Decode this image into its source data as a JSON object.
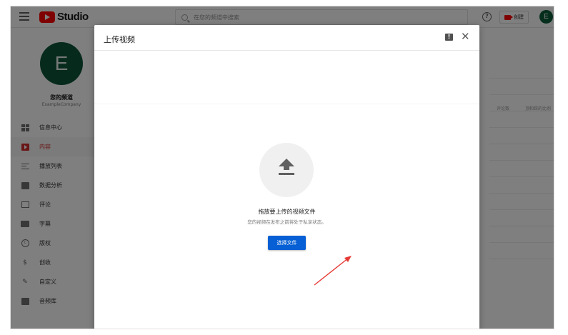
{
  "topbar": {
    "logo_text": "Studio",
    "search_placeholder": "在您的频道中搜索",
    "help_symbol": "?",
    "create_label": "创建",
    "avatar_letter": "E"
  },
  "sidebar": {
    "avatar_letter": "E",
    "channel_name": "您的频道",
    "channel_sub": "ExampleCompany",
    "items": [
      {
        "label": "信息中心",
        "icon": "dashboard-icon"
      },
      {
        "label": "内容",
        "icon": "content-icon",
        "active": true
      },
      {
        "label": "播放列表",
        "icon": "playlist-icon"
      },
      {
        "label": "数据分析",
        "icon": "analytics-icon"
      },
      {
        "label": "评论",
        "icon": "comments-icon"
      },
      {
        "label": "字幕",
        "icon": "subtitles-icon"
      },
      {
        "label": "版权",
        "icon": "copyright-icon"
      },
      {
        "label": "创收",
        "icon": "monetization-icon"
      },
      {
        "label": "自定义",
        "icon": "customize-icon"
      },
      {
        "label": "音频库",
        "icon": "audio-library-icon"
      }
    ]
  },
  "background": {
    "col_comments": "评论数",
    "col_likes": "顶和踩的比例"
  },
  "dialog": {
    "title": "上传视频",
    "drag_text": "拖放要上传的视频文件",
    "private_text": "您的视频在发布之前将处于私享状态。",
    "select_button": "选择文件",
    "feedback_symbol": "!",
    "close_symbol": "✕"
  },
  "colors": {
    "accent_red": "#ff0000",
    "active_red": "#d32f2f",
    "button_blue": "#065fd4",
    "avatar_green": "#0d5438"
  }
}
